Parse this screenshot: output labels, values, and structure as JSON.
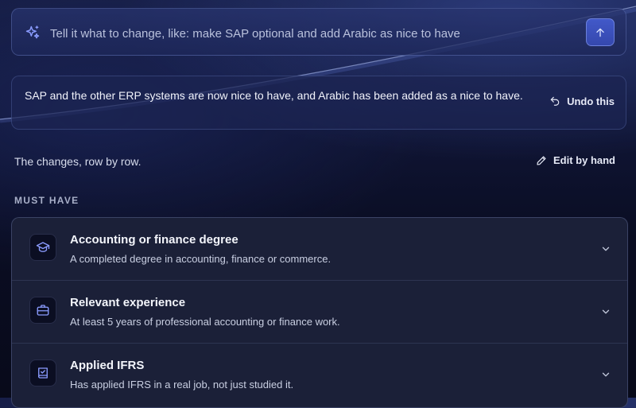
{
  "prompt": {
    "placeholder": "Tell it what to change, like: make SAP optional and add Arabic as nice to have",
    "sparkle_icon": "sparkle-icon",
    "send_icon": "arrow-up-icon"
  },
  "notice": {
    "text": "SAP and the other ERP systems are now nice to have, and Arabic has been added as a nice to have.",
    "undo_label": "Undo this",
    "undo_icon": "undo-icon"
  },
  "changes": {
    "caption": "The changes, row by row.",
    "edit_label": "Edit by hand",
    "edit_icon": "pencil-icon"
  },
  "must_have": {
    "section_label": "MUST HAVE",
    "items": [
      {
        "title": "Accounting or finance degree",
        "description": "A completed degree in accounting, finance or commerce.",
        "icon": "graduation-cap-icon"
      },
      {
        "title": "Relevant experience",
        "description": "At least 5 years of professional accounting or finance work.",
        "icon": "briefcase-icon"
      },
      {
        "title": "Applied IFRS",
        "description": "Has applied IFRS in a real job, not just studied it.",
        "icon": "book-check-icon"
      }
    ]
  },
  "colors": {
    "accent": "#3f55c4",
    "icon_accent": "#8b9cff",
    "background": "#0f1433"
  }
}
